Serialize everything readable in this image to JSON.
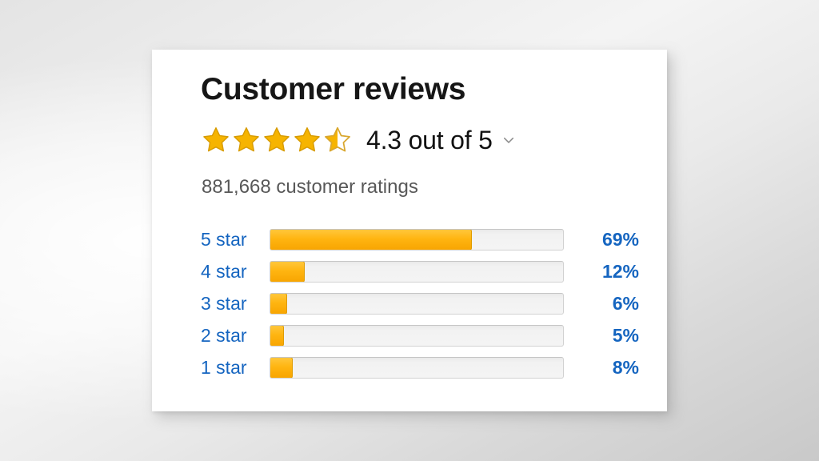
{
  "card": {
    "title": "Customer reviews",
    "score_text": "4.3 out of 5",
    "ratings_count_text": "881,668 customer ratings",
    "chevron_icon": "chevron-down-icon",
    "stars_icon": "star-rating-icon"
  },
  "colors": {
    "link_blue": "#1565c0",
    "star_gold": "#f5a623",
    "bar_fill": "#ffb511",
    "bar_track": "#f2f2f2",
    "title": "#161616",
    "muted_text": "#585858",
    "card_background": "#ffffff"
  },
  "chart_data": {
    "type": "bar",
    "title": "Customer reviews",
    "orientation": "horizontal",
    "categories": [
      "5 star",
      "4 star",
      "3 star",
      "2 star",
      "1 star"
    ],
    "values": [
      69,
      12,
      6,
      5,
      8
    ],
    "value_labels": [
      "69%",
      "12%",
      "6%",
      "5%",
      "8%"
    ],
    "xlabel": "",
    "ylabel": "",
    "xlim": [
      0,
      100
    ],
    "grid": false,
    "legend": "none",
    "average_rating": 4.3,
    "rating_scale_max": 5,
    "stars_filled": 4.5,
    "total_ratings": 881668,
    "total_ratings_label": "881,668 customer ratings"
  }
}
